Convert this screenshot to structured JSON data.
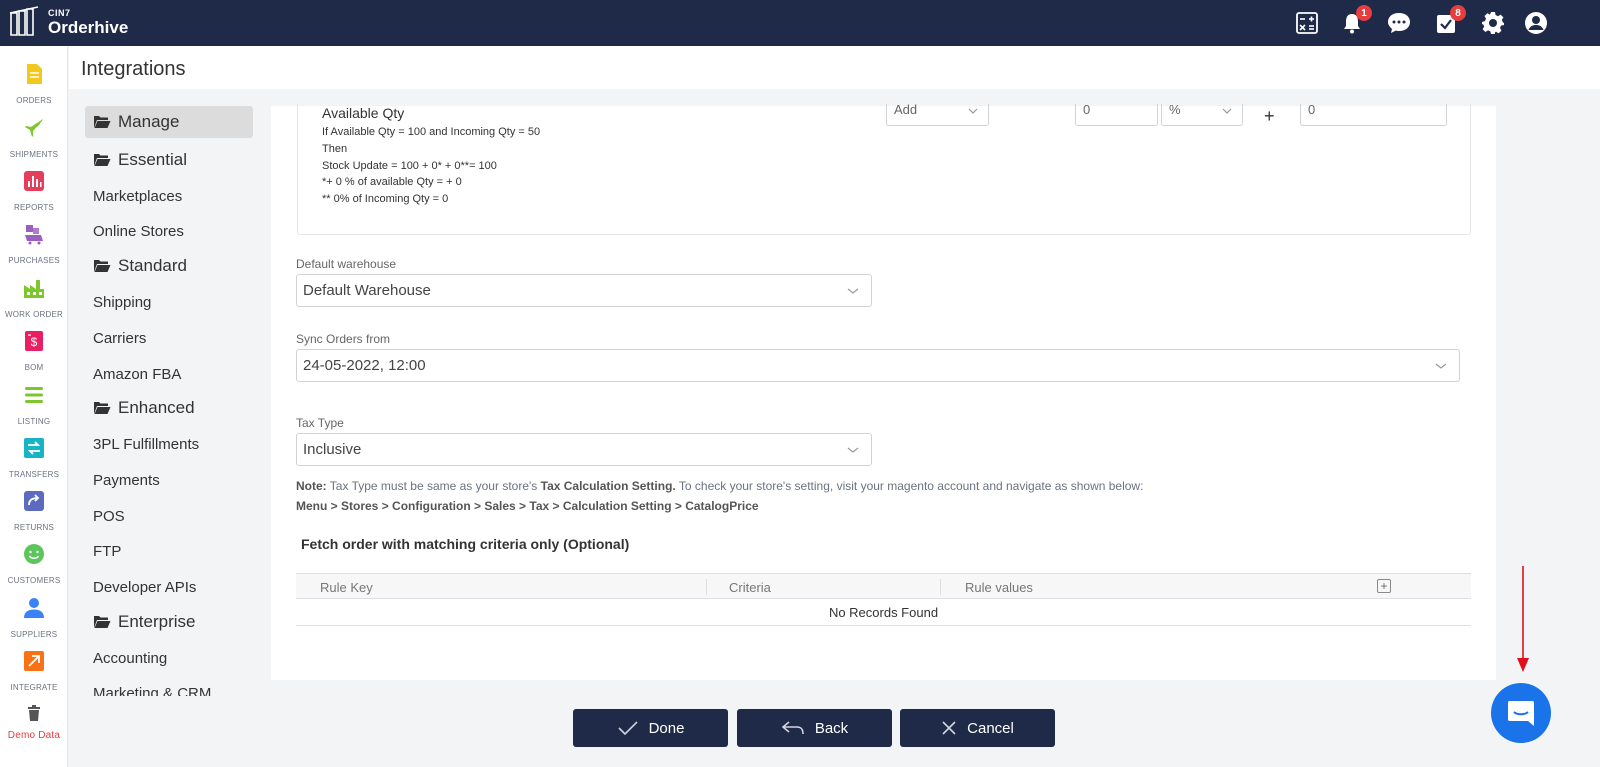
{
  "brand": {
    "small": "CIN7",
    "name": "Orderhive"
  },
  "topbar": {
    "icons": [
      {
        "name": "calculator-icon"
      },
      {
        "name": "bell-icon",
        "badge": "1"
      },
      {
        "name": "chat-icon"
      },
      {
        "name": "tasks-icon",
        "badge": "8"
      },
      {
        "name": "gear-icon"
      },
      {
        "name": "user-icon"
      }
    ]
  },
  "rail": [
    {
      "label": "ORDERS",
      "icon": "orders-icon",
      "color": "#f2c81d"
    },
    {
      "label": "SHIPMENTS",
      "icon": "airplane-icon",
      "color": "#7cc62e"
    },
    {
      "label": "REPORTS",
      "icon": "reports-icon",
      "color": "#e53e5a"
    },
    {
      "label": "PURCHASES",
      "icon": "cart-icon",
      "color": "#9b5fc0"
    },
    {
      "label": "WORK ORDER",
      "icon": "factory-icon",
      "color": "#7cc62e"
    },
    {
      "label": "BOM",
      "icon": "bom-icon",
      "color": "#e91e63"
    },
    {
      "label": "LISTING",
      "icon": "listing-icon",
      "color": "#7cc62e"
    },
    {
      "label": "TRANSFERS",
      "icon": "transfers-icon",
      "color": "#18b3c6"
    },
    {
      "label": "RETURNS",
      "icon": "returns-icon",
      "color": "#5c6bc0"
    },
    {
      "label": "CUSTOMERS",
      "icon": "smiley-icon",
      "color": "#5cc65c"
    },
    {
      "label": "SUPPLIERS",
      "icon": "person-icon",
      "color": "#3b82f6"
    },
    {
      "label": "INTEGRATE",
      "icon": "integrate-icon",
      "color": "#f97316"
    },
    {
      "label": "Demo Data",
      "icon": "trash-icon",
      "color": "#e53e3e"
    }
  ],
  "page": {
    "title": "Integrations"
  },
  "subnav": [
    {
      "label": "Manage",
      "folder": true,
      "active": true
    },
    {
      "label": "Essential",
      "folder": true
    },
    {
      "label": "Marketplaces"
    },
    {
      "label": "Online Stores"
    },
    {
      "label": "Standard",
      "folder": true
    },
    {
      "label": "Shipping"
    },
    {
      "label": "Carriers"
    },
    {
      "label": "Amazon FBA"
    },
    {
      "label": "Enhanced",
      "folder": true
    },
    {
      "label": "3PL Fulfillments"
    },
    {
      "label": "Payments"
    },
    {
      "label": "POS"
    },
    {
      "label": "FTP"
    },
    {
      "label": "Developer APIs"
    },
    {
      "label": "Enterprise",
      "folder": true
    },
    {
      "label": "Accounting"
    },
    {
      "label": "Marketing & CRM"
    }
  ],
  "available_qty": {
    "title": "Available Qty",
    "lines": [
      "If Available Qty = 100 and Incoming Qty = 50",
      "Then",
      "Stock Update = 100 + 0* + 0**= 100",
      "*+ 0 % of available Qty = + 0",
      "** 0% of Incoming Qty = 0"
    ],
    "operation": "Add",
    "percent_value": "0",
    "unit": "%",
    "plus": "+",
    "fixed_value": "0"
  },
  "default_warehouse": {
    "label": "Default warehouse",
    "value": "Default Warehouse"
  },
  "sync_orders": {
    "label": "Sync Orders from",
    "value": "24-05-2022, 12:00"
  },
  "tax_type": {
    "label": "Tax Type",
    "value": "Inclusive"
  },
  "note": {
    "prefix": "Note:",
    "text1": " Tax Type must be same as your store's ",
    "bold1": "Tax Calculation Setting.",
    "text2": " To check your store's setting, visit your magento account and navigate as shown below:",
    "path": "Menu > Stores > Configuration > Sales > Tax > Calculation Setting > CatalogPrice"
  },
  "criteria": {
    "title": "Fetch order with matching criteria only (Optional)",
    "columns": [
      "Rule Key",
      "Criteria",
      "Rule values"
    ],
    "add_label": "+",
    "empty_text": "No Records Found"
  },
  "footer": {
    "done": "Done",
    "back": "Back",
    "cancel": "Cancel"
  },
  "colors": {
    "navy": "#1e2a47",
    "chat_blue": "#1a73e8",
    "arrow_red": "#e0101a"
  }
}
